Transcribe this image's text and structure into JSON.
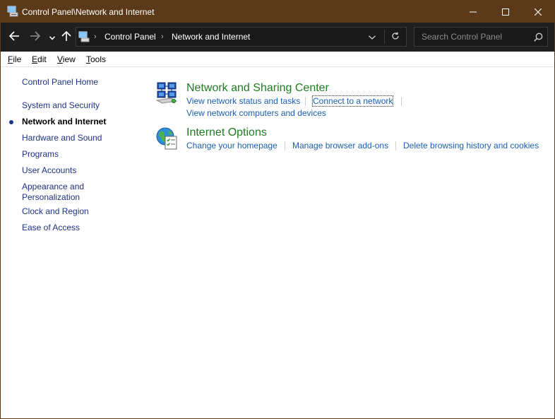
{
  "window": {
    "title": "Control Panel\\Network and Internet",
    "icons": {
      "app": "control-panel-icon",
      "minimize": "minimize-icon",
      "maximize": "maximize-icon",
      "close": "close-icon"
    }
  },
  "navbar": {
    "breadcrumbs": [
      "Control Panel",
      "Network and Internet"
    ],
    "search_placeholder": "Search Control Panel"
  },
  "menu": {
    "items": [
      {
        "underline": "F",
        "rest": "ile"
      },
      {
        "underline": "E",
        "rest": "dit"
      },
      {
        "underline": "V",
        "rest": "iew"
      },
      {
        "underline": "T",
        "rest": "ools"
      }
    ]
  },
  "sidebar": {
    "home": "Control Panel Home",
    "items": [
      {
        "label": "System and Security"
      },
      {
        "label": "Network and Internet",
        "current": true
      },
      {
        "label": "Hardware and Sound"
      },
      {
        "label": "Programs"
      },
      {
        "label": "User Accounts"
      },
      {
        "label": "Appearance and Personalization",
        "line1": "Appearance and",
        "line2": "Personalization"
      },
      {
        "label": "Clock and Region"
      },
      {
        "label": "Ease of Access"
      }
    ]
  },
  "categories": [
    {
      "title": "Network and Sharing Center",
      "icon": "network-sharing-center-icon",
      "tasks": [
        "View network status and tasks",
        "Connect to a network",
        "View network computers and devices"
      ]
    },
    {
      "title": "Internet Options",
      "icon": "internet-options-icon",
      "tasks": [
        "Change your homepage",
        "Manage browser add-ons",
        "Delete browsing history and cookies"
      ]
    }
  ],
  "colors": {
    "titlebar": "#5b3a19",
    "navbar": "#1f1f1f",
    "category_title": "#1e7c1e",
    "task_link": "#1a5fb4",
    "nav_link": "#1e3287"
  }
}
